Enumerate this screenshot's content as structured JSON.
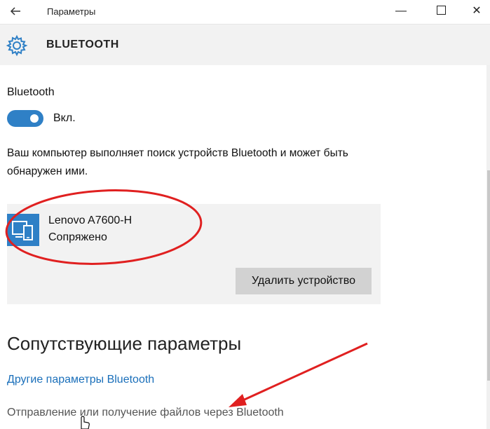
{
  "window": {
    "title": "Параметры",
    "back_icon": "arrow-left-icon",
    "minimize_glyph": "—",
    "close_glyph": "✕"
  },
  "header": {
    "icon": "gear-icon",
    "title": "BLUETOOTH"
  },
  "bluetooth": {
    "label": "Bluetooth",
    "toggle_state": "Вкл.",
    "description": "Ваш компьютер выполняет поиск устройств Bluetooth и может быть обнаружен ими."
  },
  "device": {
    "icon": "phone-device-icon",
    "name": "Lenovo A7600-H",
    "status": "Сопряжено",
    "remove_label": "Удалить устройство"
  },
  "related": {
    "title": "Сопутствующие параметры",
    "link_other": "Другие параметры Bluetooth",
    "link_send": "Отправление или получение файлов через Bluetooth"
  },
  "colors": {
    "accent": "#2f80c6",
    "link": "#1a6fba",
    "annotation": "#e02020"
  }
}
